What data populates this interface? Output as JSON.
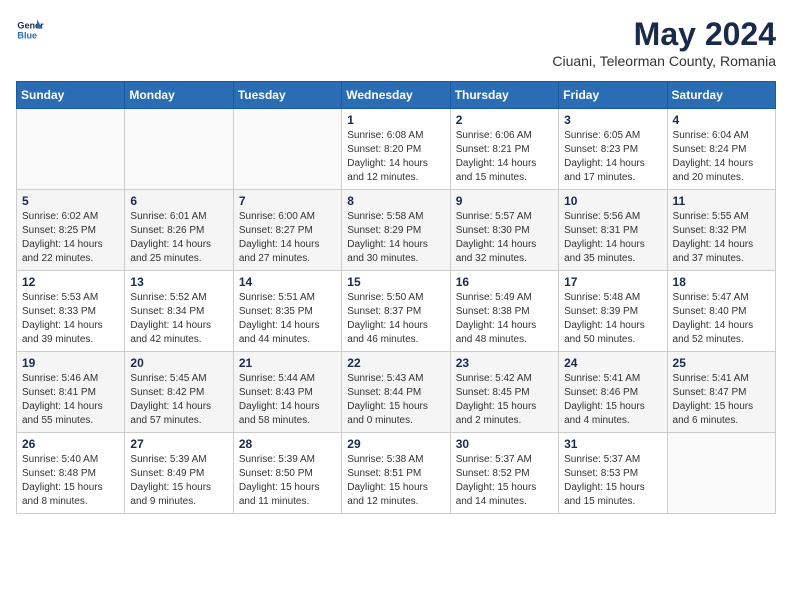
{
  "header": {
    "logo_general": "General",
    "logo_blue": "Blue",
    "month_year": "May 2024",
    "location": "Ciuani, Teleorman County, Romania"
  },
  "days_of_week": [
    "Sunday",
    "Monday",
    "Tuesday",
    "Wednesday",
    "Thursday",
    "Friday",
    "Saturday"
  ],
  "weeks": [
    [
      {
        "day": "",
        "info": ""
      },
      {
        "day": "",
        "info": ""
      },
      {
        "day": "",
        "info": ""
      },
      {
        "day": "1",
        "info": "Sunrise: 6:08 AM\nSunset: 8:20 PM\nDaylight: 14 hours\nand 12 minutes."
      },
      {
        "day": "2",
        "info": "Sunrise: 6:06 AM\nSunset: 8:21 PM\nDaylight: 14 hours\nand 15 minutes."
      },
      {
        "day": "3",
        "info": "Sunrise: 6:05 AM\nSunset: 8:23 PM\nDaylight: 14 hours\nand 17 minutes."
      },
      {
        "day": "4",
        "info": "Sunrise: 6:04 AM\nSunset: 8:24 PM\nDaylight: 14 hours\nand 20 minutes."
      }
    ],
    [
      {
        "day": "5",
        "info": "Sunrise: 6:02 AM\nSunset: 8:25 PM\nDaylight: 14 hours\nand 22 minutes."
      },
      {
        "day": "6",
        "info": "Sunrise: 6:01 AM\nSunset: 8:26 PM\nDaylight: 14 hours\nand 25 minutes."
      },
      {
        "day": "7",
        "info": "Sunrise: 6:00 AM\nSunset: 8:27 PM\nDaylight: 14 hours\nand 27 minutes."
      },
      {
        "day": "8",
        "info": "Sunrise: 5:58 AM\nSunset: 8:29 PM\nDaylight: 14 hours\nand 30 minutes."
      },
      {
        "day": "9",
        "info": "Sunrise: 5:57 AM\nSunset: 8:30 PM\nDaylight: 14 hours\nand 32 minutes."
      },
      {
        "day": "10",
        "info": "Sunrise: 5:56 AM\nSunset: 8:31 PM\nDaylight: 14 hours\nand 35 minutes."
      },
      {
        "day": "11",
        "info": "Sunrise: 5:55 AM\nSunset: 8:32 PM\nDaylight: 14 hours\nand 37 minutes."
      }
    ],
    [
      {
        "day": "12",
        "info": "Sunrise: 5:53 AM\nSunset: 8:33 PM\nDaylight: 14 hours\nand 39 minutes."
      },
      {
        "day": "13",
        "info": "Sunrise: 5:52 AM\nSunset: 8:34 PM\nDaylight: 14 hours\nand 42 minutes."
      },
      {
        "day": "14",
        "info": "Sunrise: 5:51 AM\nSunset: 8:35 PM\nDaylight: 14 hours\nand 44 minutes."
      },
      {
        "day": "15",
        "info": "Sunrise: 5:50 AM\nSunset: 8:37 PM\nDaylight: 14 hours\nand 46 minutes."
      },
      {
        "day": "16",
        "info": "Sunrise: 5:49 AM\nSunset: 8:38 PM\nDaylight: 14 hours\nand 48 minutes."
      },
      {
        "day": "17",
        "info": "Sunrise: 5:48 AM\nSunset: 8:39 PM\nDaylight: 14 hours\nand 50 minutes."
      },
      {
        "day": "18",
        "info": "Sunrise: 5:47 AM\nSunset: 8:40 PM\nDaylight: 14 hours\nand 52 minutes."
      }
    ],
    [
      {
        "day": "19",
        "info": "Sunrise: 5:46 AM\nSunset: 8:41 PM\nDaylight: 14 hours\nand 55 minutes."
      },
      {
        "day": "20",
        "info": "Sunrise: 5:45 AM\nSunset: 8:42 PM\nDaylight: 14 hours\nand 57 minutes."
      },
      {
        "day": "21",
        "info": "Sunrise: 5:44 AM\nSunset: 8:43 PM\nDaylight: 14 hours\nand 58 minutes."
      },
      {
        "day": "22",
        "info": "Sunrise: 5:43 AM\nSunset: 8:44 PM\nDaylight: 15 hours\nand 0 minutes."
      },
      {
        "day": "23",
        "info": "Sunrise: 5:42 AM\nSunset: 8:45 PM\nDaylight: 15 hours\nand 2 minutes."
      },
      {
        "day": "24",
        "info": "Sunrise: 5:41 AM\nSunset: 8:46 PM\nDaylight: 15 hours\nand 4 minutes."
      },
      {
        "day": "25",
        "info": "Sunrise: 5:41 AM\nSunset: 8:47 PM\nDaylight: 15 hours\nand 6 minutes."
      }
    ],
    [
      {
        "day": "26",
        "info": "Sunrise: 5:40 AM\nSunset: 8:48 PM\nDaylight: 15 hours\nand 8 minutes."
      },
      {
        "day": "27",
        "info": "Sunrise: 5:39 AM\nSunset: 8:49 PM\nDaylight: 15 hours\nand 9 minutes."
      },
      {
        "day": "28",
        "info": "Sunrise: 5:39 AM\nSunset: 8:50 PM\nDaylight: 15 hours\nand 11 minutes."
      },
      {
        "day": "29",
        "info": "Sunrise: 5:38 AM\nSunset: 8:51 PM\nDaylight: 15 hours\nand 12 minutes."
      },
      {
        "day": "30",
        "info": "Sunrise: 5:37 AM\nSunset: 8:52 PM\nDaylight: 15 hours\nand 14 minutes."
      },
      {
        "day": "31",
        "info": "Sunrise: 5:37 AM\nSunset: 8:53 PM\nDaylight: 15 hours\nand 15 minutes."
      },
      {
        "day": "",
        "info": ""
      }
    ]
  ]
}
